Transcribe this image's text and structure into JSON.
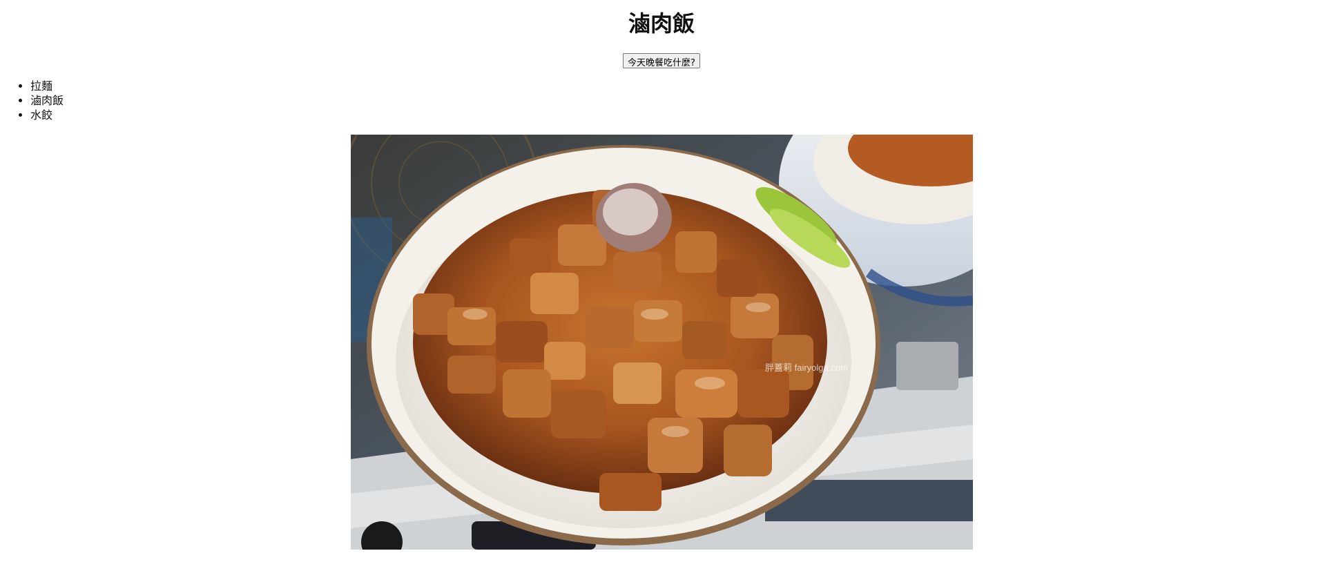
{
  "page": {
    "title": "滷肉飯"
  },
  "action_button": {
    "label": "今天晚餐吃什麼?"
  },
  "menu": {
    "items": [
      "拉麵",
      "滷肉飯",
      "水餃"
    ]
  },
  "photo": {
    "watermark": "胖蓋莉 fairyolga.com"
  }
}
